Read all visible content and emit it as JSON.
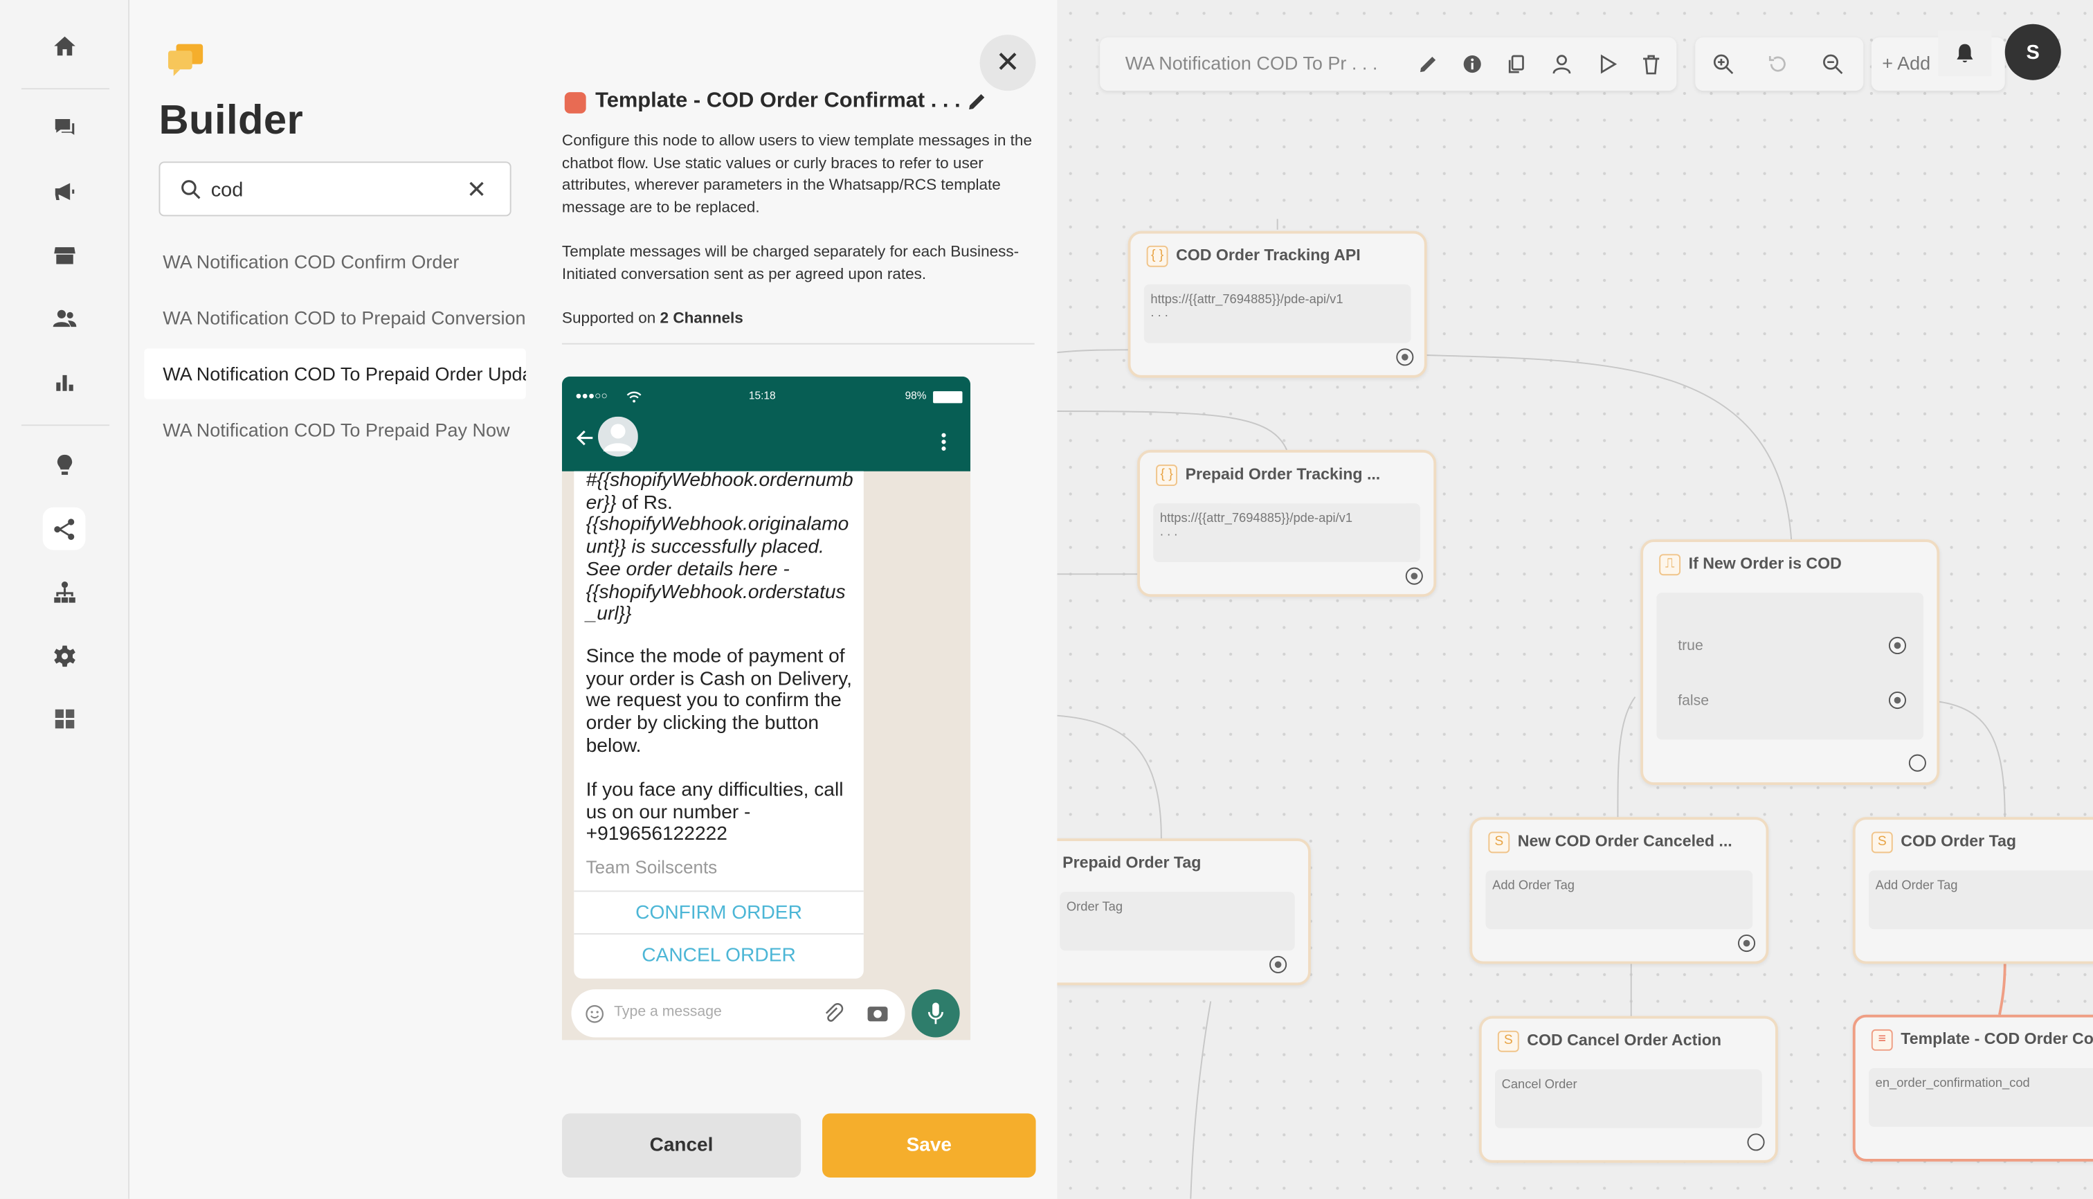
{
  "builder": {
    "title": "Builder",
    "search": {
      "value": "cod"
    },
    "results": [
      "WA Notification COD Confirm Order",
      "WA Notification COD to Prepaid Conversion",
      "WA Notification COD To Prepaid Order Upda",
      "WA Notification COD To Prepaid Pay Now"
    ]
  },
  "config": {
    "title": "Template - COD Order Confirmat . . .",
    "description_1": "Configure this node to allow users to view template messages in the chatbot flow. Use static values or curly braces to refer to user attributes, wherever parameters in the Whatsapp/RCS template message are to be replaced.",
    "description_2": "Template messages will be charged separately for each Business-Initiated conversation sent as per agreed upon rates.",
    "supported_prefix": "Supported on ",
    "supported_channels": "2 Channels",
    "cancel_label": "Cancel",
    "save_label": "Save"
  },
  "preview": {
    "status_time": "15:18",
    "status_battery": "98%",
    "message_part1_a": "#{{shopifyWebhook.ordernumb er}}",
    "message_part1_b": " of Rs.",
    "message_part1_c": "{{shopifyWebhook.originalamo unt}} is successfully placed. See order details here - {{shopifyWebhook.orderstatus _url}}",
    "message_part2": "Since the mode of payment of your order is Cash on Delivery, we request you to confirm the order by clicking the button below.",
    "message_part3": "If you face any difficulties, call us on our number - +919656122222",
    "signature": "Team Soilscents",
    "button_1": "CONFIRM ORDER",
    "button_2": "CANCEL ORDER",
    "composer_placeholder": "Type a message"
  },
  "canvas": {
    "flow_name": "WA Notification COD To Pr . . .",
    "add_label": "+ Add",
    "avatar_initial": "S",
    "nodes": {
      "cod_tracking": {
        "title": "COD Order Tracking API",
        "body": "https://{{attr_7694885}}/pde-api/v1",
        "dots": ". . ."
      },
      "prepaid_tracking": {
        "title": "Prepaid Order Tracking ...",
        "body": "https://{{attr_7694885}}/pde-api/v1",
        "dots": ". . ."
      },
      "if_cod": {
        "title": "If New Order is COD",
        "true_label": "true",
        "false_label": "false"
      },
      "prepaid_tag": {
        "title": "Prepaid Order Tag",
        "body": "Order Tag"
      },
      "new_cod_canceled": {
        "title": "New COD Order Canceled ...",
        "body": "Add Order Tag"
      },
      "cod_tag": {
        "title": "COD Order Tag",
        "body": "Add Order Tag"
      },
      "cod_cancel_action": {
        "title": "COD Cancel Order Action",
        "body": "Cancel Order"
      },
      "template_cod": {
        "title": "Template - COD Order Co...",
        "body": "en_order_confirmation_cod"
      }
    }
  },
  "colors": {
    "accent": "#f5ae2c",
    "whatsapp_header": "#075e54",
    "link": "#4cb6d6",
    "highlight_border": "#ef9e84"
  }
}
